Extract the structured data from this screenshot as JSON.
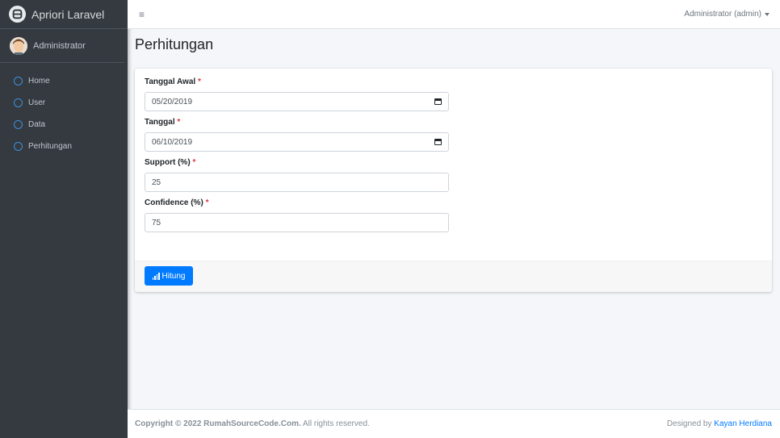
{
  "sidebar": {
    "brand": "Apriori Laravel",
    "user_name": "Administrator",
    "items": [
      {
        "label": "Home"
      },
      {
        "label": "User"
      },
      {
        "label": "Data"
      },
      {
        "label": "Perhitungan"
      }
    ]
  },
  "header": {
    "menu_icon": "≡",
    "user_menu": "Administrator (admin)"
  },
  "page_title": "Perhitungan",
  "form": {
    "tanggal_awal": {
      "label": "Tanggal Awal",
      "required": "*",
      "value": "05/20/2019"
    },
    "tanggal": {
      "label": "Tanggal",
      "required": "*",
      "value": "06/10/2019"
    },
    "support": {
      "label": "Support (%)",
      "required": "*",
      "value": "25"
    },
    "confidence": {
      "label": "Confidence (%)",
      "required": "*",
      "value": "75"
    },
    "submit_label": "Hitung"
  },
  "footer": {
    "copyright_prefix": "Copyright © 2022 RumahSourceCode.Com.",
    "rights": " All rights reserved.",
    "designed_by": "Designed by ",
    "designer": "Kayan Herdiana"
  },
  "colors": {
    "sidebar_bg": "#343a40",
    "primary": "#007bff",
    "required": "#dc3545"
  }
}
